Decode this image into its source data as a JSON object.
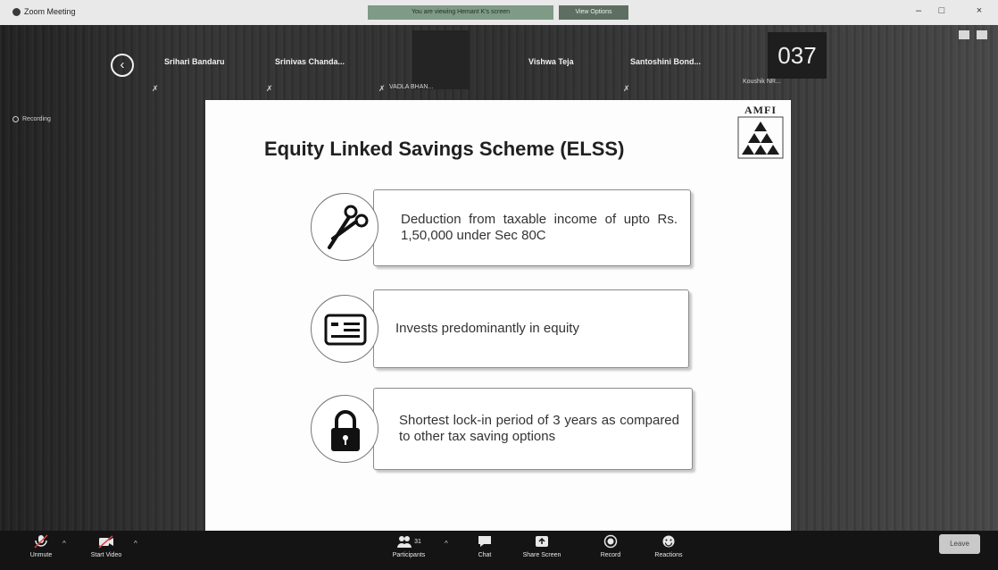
{
  "window": {
    "title": "Zoom Meeting",
    "share_banner": "You are viewing Hemant K's screen",
    "view_options": "View Options",
    "controls": [
      "–",
      "□",
      "×"
    ]
  },
  "gallery": {
    "participants": [
      "Srihari Bandaru",
      "Srinivas Chanda...",
      "Vishwa Teja",
      "Santoshini Bond..."
    ],
    "tile_caption": "VADLA BHAN...",
    "timer_tile": "037",
    "tile2_caption": "Koushik NR..."
  },
  "recording": {
    "label": "Recording"
  },
  "slide": {
    "title": "Equity Linked Savings Scheme (ELSS)",
    "logo_text": "AMFI",
    "points": [
      {
        "icon": "scissors-icon",
        "text": "Deduction from taxable income of upto Rs. 1,50,000 under Sec 80C"
      },
      {
        "icon": "id-card-icon",
        "text": "Invests predominantly in equity"
      },
      {
        "icon": "padlock-icon",
        "text": "Shortest lock-in period of 3 years as compared to other tax saving options"
      }
    ]
  },
  "toolbar": {
    "unmute": "Unmute",
    "start_video": "Start Video",
    "participants": "Participants",
    "participants_count": "31",
    "chat": "Chat",
    "share_screen": "Share Screen",
    "record": "Record",
    "reactions": "Reactions",
    "leave": "Leave"
  }
}
